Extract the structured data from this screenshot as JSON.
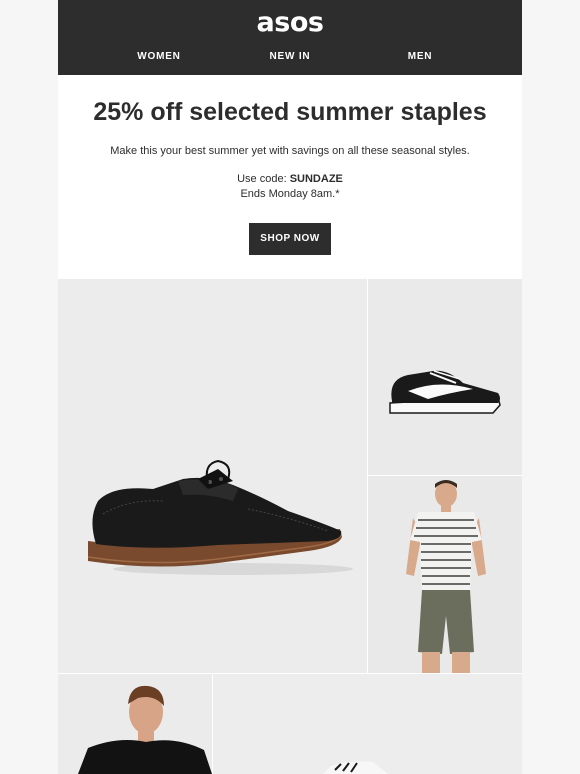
{
  "header": {
    "logo": "asos",
    "nav": [
      {
        "label": "WOMEN"
      },
      {
        "label": "NEW IN"
      },
      {
        "label": "MEN"
      }
    ]
  },
  "hero": {
    "title": "25% off selected summer staples",
    "subtitle": "Make this your best summer yet with savings on all these seasonal styles.",
    "code_prefix": "Use code: ",
    "code": "SUNDAZE",
    "ends": "Ends Monday 8am.*",
    "cta": "SHOP NOW"
  },
  "colors": {
    "header_bg": "#2d2d2d",
    "page_bg": "#f6f6f6",
    "text": "#2d2d2d",
    "button_bg": "#2d2d2d"
  },
  "products": [
    {
      "icon": "brogue-shoe-image"
    },
    {
      "icon": "sneaker-image"
    },
    {
      "icon": "striped-tshirt-model-image"
    },
    {
      "icon": "black-top-model-image"
    },
    {
      "icon": "striped-item-image"
    }
  ]
}
